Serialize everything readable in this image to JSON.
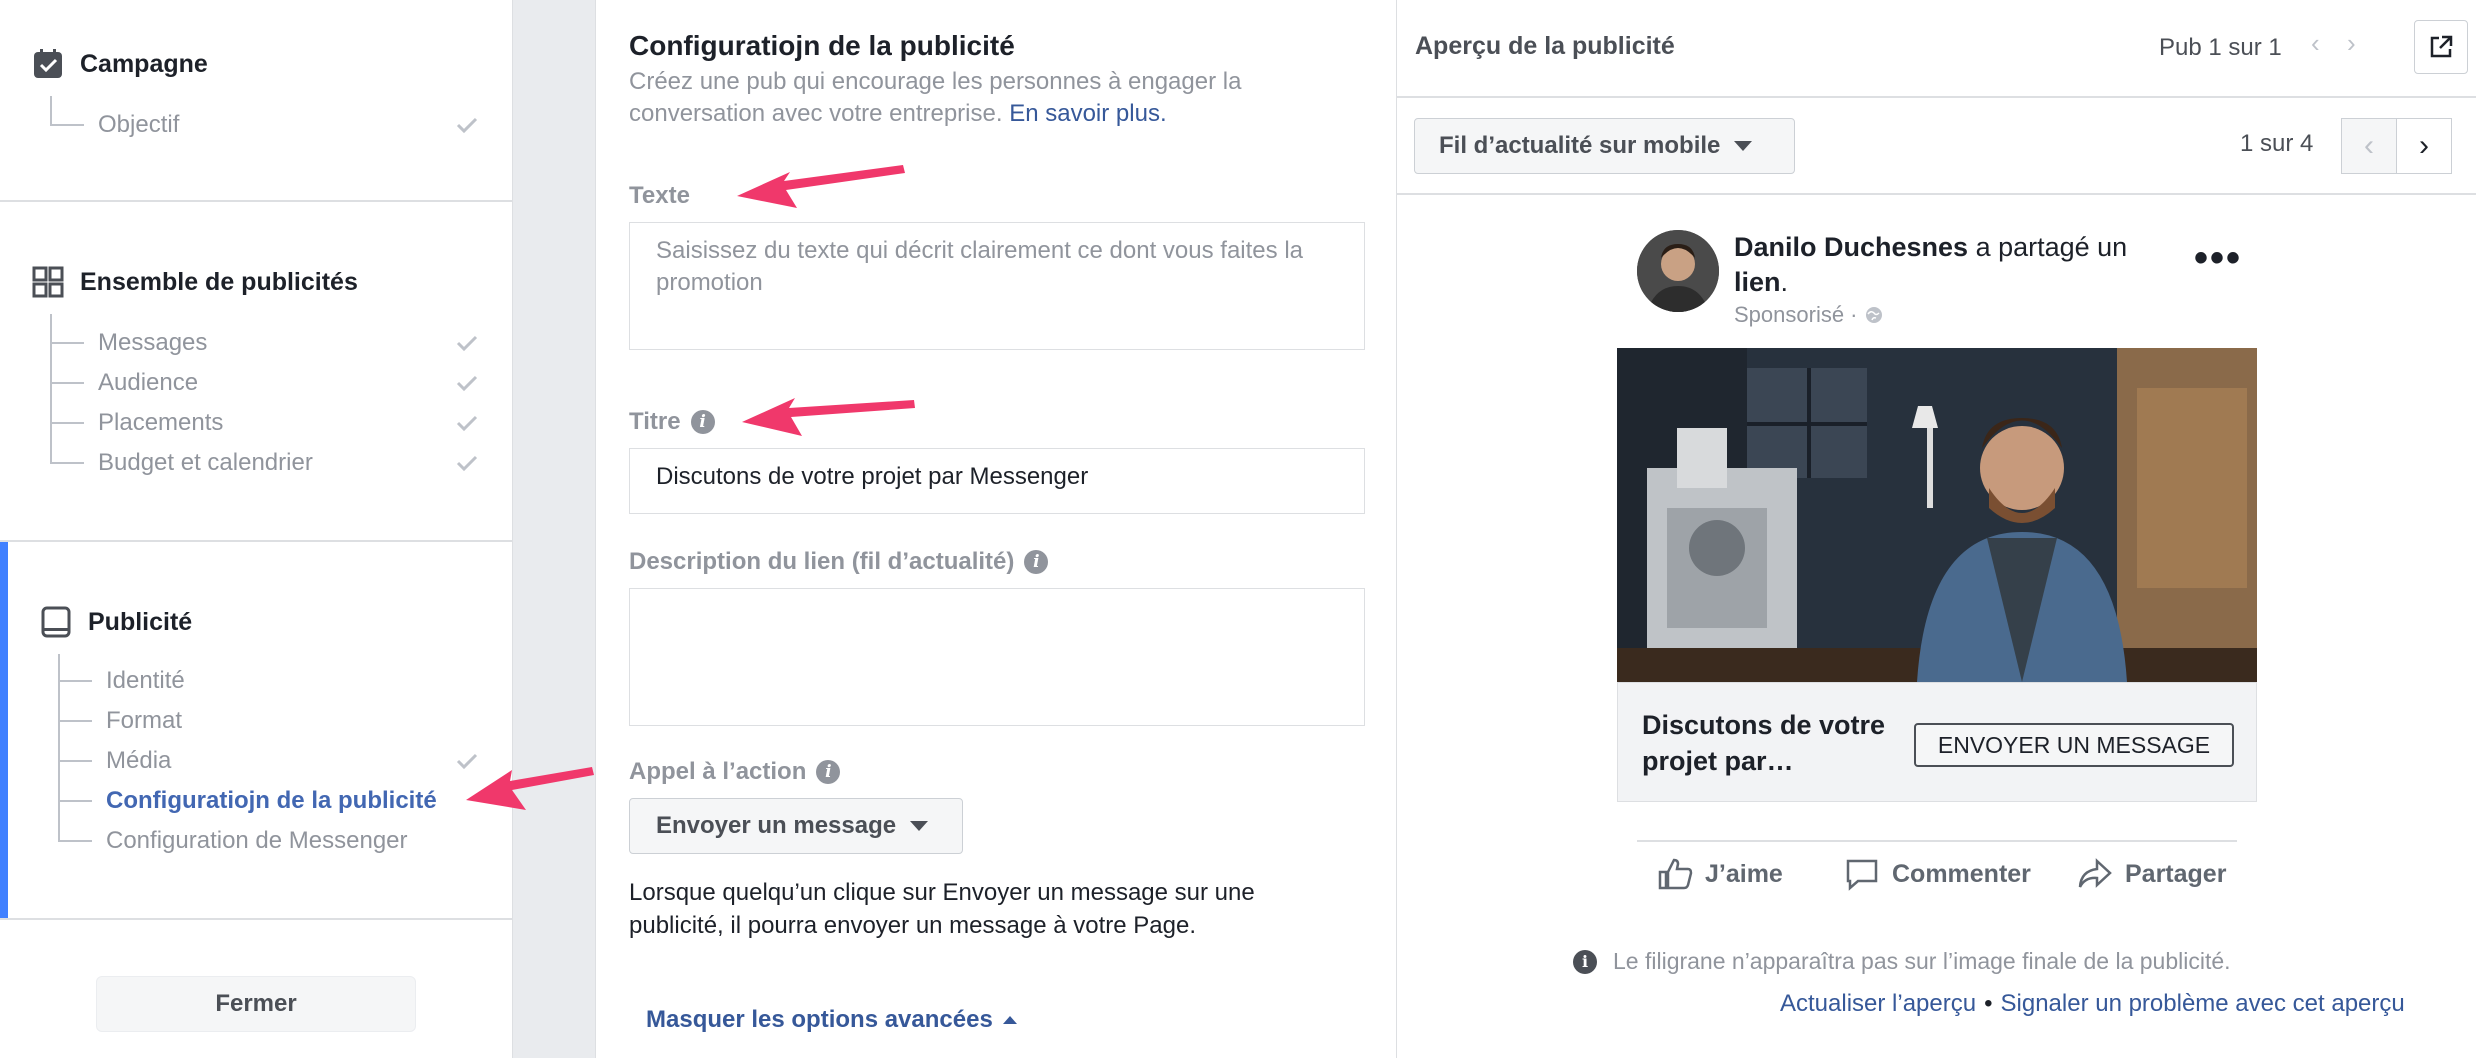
{
  "sidebar": {
    "campaign": {
      "title": "Campagne",
      "items": [
        "Objectif"
      ]
    },
    "adset": {
      "title": "Ensemble de publicités",
      "items": [
        "Messages",
        "Audience",
        "Placements",
        "Budget et calendrier"
      ]
    },
    "ad": {
      "title": "Publicité",
      "items": [
        "Identité",
        "Format",
        "Média",
        "Configuratiojn de la publicité",
        "Configuration de Messenger"
      ]
    },
    "close_label": "Fermer"
  },
  "form": {
    "title": "Configuratiojn de la publicité",
    "subtitle": "Créez une pub qui encourage les personnes à engager la conversation avec votre entreprise.",
    "learn_more": "En savoir plus.",
    "text_label": "Texte",
    "text_placeholder": "Saisissez du texte qui décrit clairement ce dont vous faites la promotion",
    "title_label": "Titre",
    "title_value": "Discutons de votre projet par Messenger",
    "link_desc_label": "Description du lien (fil d’actualité)",
    "link_desc_value": "",
    "cta_label": "Appel à l’action",
    "cta_value": "Envoyer un message",
    "cta_help": "Lorsque quelqu’un clique sur Envoyer un message sur une publicité, il pourra envoyer un message à votre Page.",
    "advanced_toggle": "Masquer les options avancées"
  },
  "preview": {
    "title": "Aperçu de la publicité",
    "ad_count": "Pub 1 sur 1",
    "placement": "Fil d’actualité sur mobile",
    "page_count": "1 sur 4",
    "post": {
      "author": "Danilo Duchesnes",
      "action": " a partagé un ",
      "object": "lien",
      "sponsored": "Sponsorisé ·",
      "headline": "Discutons de votre projet par…",
      "cta": "ENVOYER UN MESSAGE",
      "like": "J’aime",
      "comment": "Commenter",
      "share": "Partager"
    },
    "watermark_note": "Le filigrane n’apparaîtra pas sur l’image finale de la publicité.",
    "refresh_link": "Actualiser l’aperçu",
    "report_link": "Signaler un problème avec cet aperçu"
  },
  "colors": {
    "accent": "#4080ff",
    "link": "#365899",
    "arrow": "#f0386b"
  }
}
